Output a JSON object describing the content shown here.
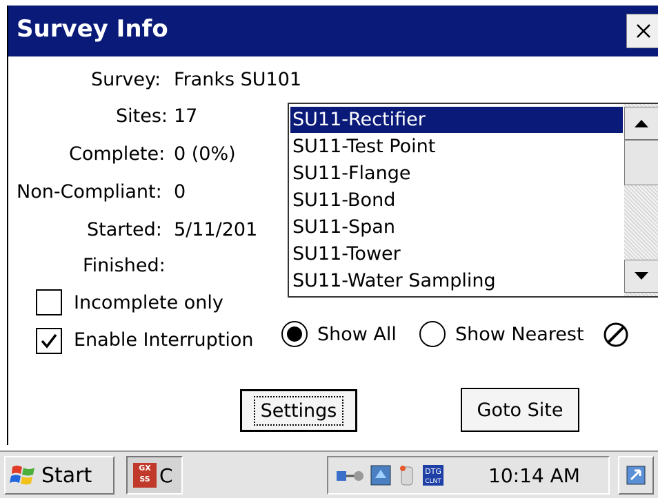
{
  "window": {
    "title": "Survey Info",
    "close_label": "✕"
  },
  "info": {
    "survey_label": "Survey:",
    "survey_value": "Franks SU101",
    "sites_label": "Sites:",
    "sites_value": "17",
    "complete_label": "Complete:",
    "complete_value": "0 (0%)",
    "noncompliant_label": "Non-Compliant:",
    "noncompliant_value": "0",
    "started_label": "Started:",
    "started_value": "5/11/201",
    "finished_label": "Finished:",
    "finished_value": ""
  },
  "site_list": {
    "items": [
      "SU11-Rectifier",
      "SU11-Test Point",
      "SU11-Flange",
      "SU11-Bond",
      "SU11-Span",
      "SU11-Tower",
      "SU11-Water Sampling"
    ],
    "selected": "SU11-Rectifier"
  },
  "options": {
    "incomplete_only_label": "Incomplete only",
    "incomplete_only_checked": false,
    "enable_interruption_label": "Enable Interruption",
    "enable_interruption_checked": true,
    "show_all_label": "Show All",
    "show_nearest_label": "Show Nearest",
    "selected_mode": "Show All",
    "gps_status_icon": "no-gps-icon"
  },
  "buttons": {
    "settings_label": "Settings",
    "goto_site_label": "Goto Site"
  },
  "taskbar": {
    "start_label": "Start",
    "app_label": "C",
    "app_icon_text": "GX SS",
    "clock": "10:14 AM"
  },
  "colors": {
    "titlebar": "#0a1a78",
    "selection": "#0a1a78"
  }
}
